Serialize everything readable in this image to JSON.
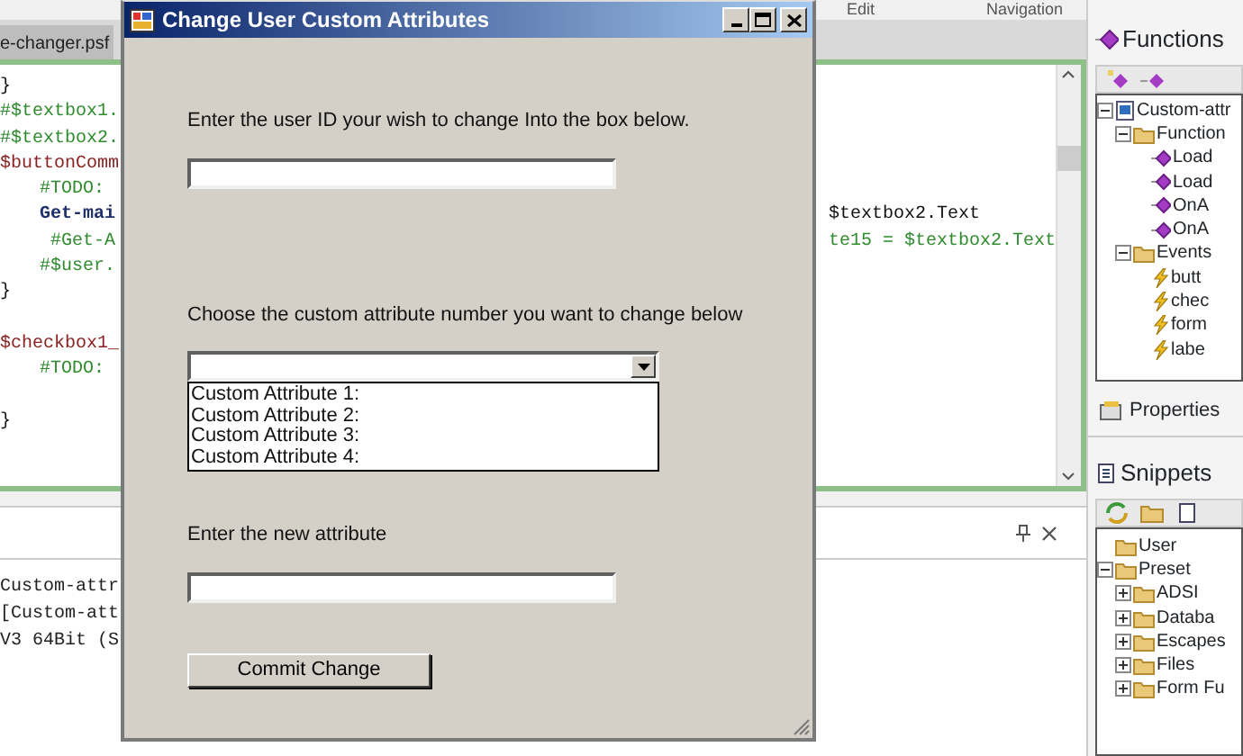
{
  "ide": {
    "menu_labels": [
      "Edit",
      "Navigation"
    ],
    "editor": {
      "tab": "e-changer.psf",
      "lines": [
        {
          "kind": "plain",
          "text": "}"
        },
        {
          "kind": "comment",
          "text": "#$textbox1."
        },
        {
          "kind": "comment",
          "text": "#$textbox2."
        },
        {
          "kind": "variable",
          "text": "$buttonComm",
          "children": [
            {
              "kind": "comment",
              "text": "#TODO:"
            },
            {
              "kind": "command",
              "text": "Get-mai",
              "continuation": {
                "kind": "plain",
                "text": "$textbox2.Text"
              },
              "children": [
                {
                  "kind": "comment",
                  "text": "#Get-A",
                  "continuation": {
                    "kind": "comment",
                    "text": "te15 = $textbox2.Text"
                  }
                }
              ]
            },
            {
              "kind": "comment",
              "text": "#$user."
            }
          ]
        },
        {
          "kind": "plain",
          "text": "}"
        },
        {
          "kind": "blank"
        },
        {
          "kind": "variable",
          "text": "$checkbox1_",
          "children": [
            {
              "kind": "comment",
              "text": "#TODO:"
            },
            {
              "kind": "blank"
            }
          ]
        },
        {
          "kind": "plain",
          "text": "}"
        }
      ]
    },
    "output": {
      "lines": [
        "Custom-attr",
        "[Custom-att",
        "V3 64Bit (S"
      ]
    },
    "functions": {
      "title": "Functions",
      "tree": [
        {
          "label": "Custom-attr",
          "kind": "file",
          "expanded": true,
          "children": [
            {
              "label": "Function",
              "kind": "folder",
              "expanded": true,
              "children": [
                {
                  "label": "Load",
                  "kind": "function"
                },
                {
                  "label": "Load",
                  "kind": "function"
                },
                {
                  "label": "OnA",
                  "kind": "function"
                },
                {
                  "label": "OnA",
                  "kind": "function"
                }
              ]
            },
            {
              "label": "Events",
              "kind": "folder",
              "expanded": true,
              "children": [
                {
                  "label": "butt",
                  "kind": "event"
                },
                {
                  "label": "chec",
                  "kind": "event"
                },
                {
                  "label": "form",
                  "kind": "event"
                },
                {
                  "label": "labe",
                  "kind": "event"
                }
              ]
            }
          ]
        }
      ],
      "tab": "Properties"
    },
    "snippets": {
      "title": "Snippets",
      "tree": [
        {
          "label": "User",
          "kind": "folder"
        },
        {
          "label": "Preset",
          "kind": "folder",
          "expanded": true,
          "children": [
            {
              "label": "ADSI",
              "kind": "folder",
              "expanded": false
            },
            {
              "label": "Databa",
              "kind": "folder",
              "expanded": false
            },
            {
              "label": "Escapes",
              "kind": "folder",
              "expanded": false
            },
            {
              "label": "Files",
              "kind": "folder",
              "expanded": false
            },
            {
              "label": "Form Fu",
              "kind": "folder",
              "expanded": false
            }
          ]
        }
      ]
    }
  },
  "dialog": {
    "title": "Change User Custom Attributes",
    "user_id": {
      "label": "Enter the user ID your wish to change Into the box below."
    },
    "attribute": {
      "label": "Choose the custom attribute number you want to change below",
      "expanded": true,
      "options": [
        "Custom Attribute 1:",
        "Custom Attribute 2:",
        "Custom Attribute 3:",
        "Custom Attribute 4:"
      ]
    },
    "new_value": {
      "label": "Enter the new attribute"
    },
    "button": "Commit Change"
  }
}
